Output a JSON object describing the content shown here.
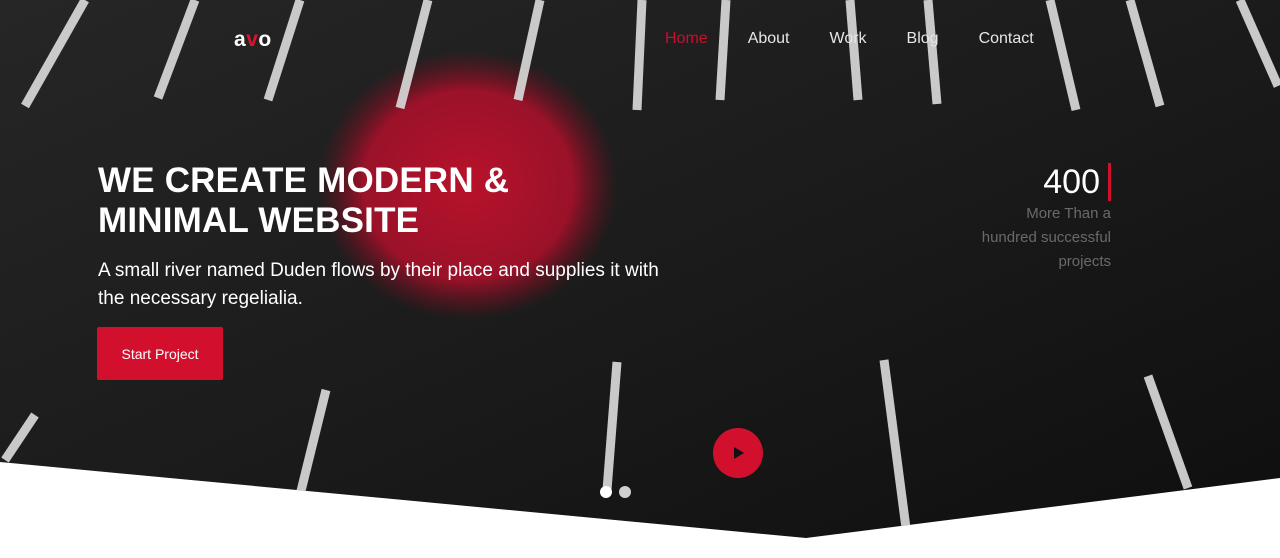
{
  "brand": {
    "logo_part1": "a",
    "logo_accent": "v",
    "logo_part2": "o",
    "accent_color": "#d2102e"
  },
  "nav": {
    "items": [
      {
        "label": "Home",
        "active": true
      },
      {
        "label": "About",
        "active": false
      },
      {
        "label": "Work",
        "active": false
      },
      {
        "label": "Blog",
        "active": false
      },
      {
        "label": "Contact",
        "active": false
      }
    ]
  },
  "hero": {
    "headline_line1": "WE CREATE MODERN &",
    "headline_line2": "MINIMAL WEBSITE",
    "subtitle": "A small river named Duden flows by their place and supplies it with the necessary regelialia.",
    "cta_label": "Start Project",
    "play_icon": "play-icon"
  },
  "stat": {
    "number": "400",
    "line1": "More Than a",
    "line2": "hundred successful",
    "line3": "projects"
  },
  "slider": {
    "slide_count": 2,
    "active_slide": 1
  }
}
